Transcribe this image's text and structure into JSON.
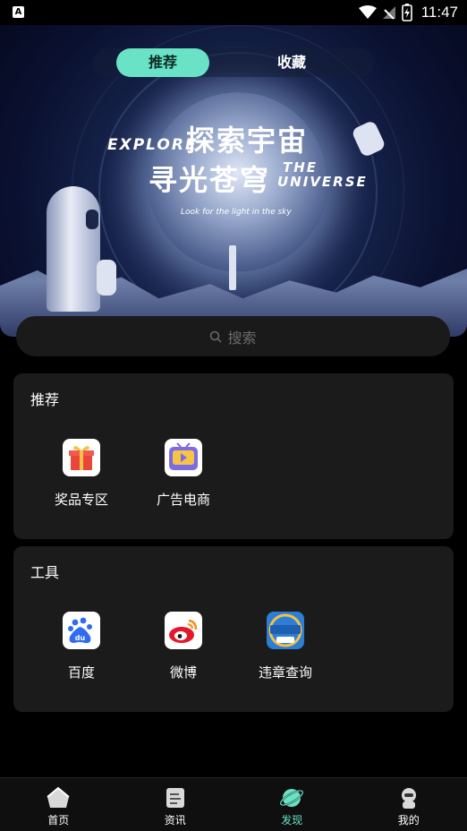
{
  "status_bar": {
    "time": "11:47",
    "app_icon_letter": "A"
  },
  "banner": {
    "tabs": [
      {
        "label": "推荐",
        "active": true
      },
      {
        "label": "收藏",
        "active": false
      }
    ],
    "headline_cn_1": "探索宇宙",
    "headline_cn_2": "寻光苍穹",
    "headline_en_1": "EXPLORE",
    "headline_en_2a": "THE",
    "headline_en_2b": "UNIVERSE",
    "tagline": "Look for the light in the sky"
  },
  "search": {
    "placeholder": "搜索",
    "icon": "search-icon"
  },
  "sections": [
    {
      "title": "推荐",
      "items": [
        {
          "label": "奖品专区",
          "icon": "gift-icon",
          "color": "#e8463a"
        },
        {
          "label": "广告电商",
          "icon": "tv-play-icon",
          "color": "#7b6ce6"
        }
      ]
    },
    {
      "title": "工具",
      "items": [
        {
          "label": "百度",
          "icon": "baidu-icon",
          "color": "#2f6cf0"
        },
        {
          "label": "微博",
          "icon": "weibo-icon",
          "color": "#e6162d"
        },
        {
          "label": "违章查询",
          "icon": "traffic-violation-icon",
          "color": "#2d7fd6",
          "badge": "违章查询"
        }
      ]
    }
  ],
  "bottom_nav": [
    {
      "label": "首页",
      "icon": "home-icon",
      "active": false
    },
    {
      "label": "资讯",
      "icon": "news-icon",
      "active": false
    },
    {
      "label": "发现",
      "icon": "planet-icon",
      "active": true
    },
    {
      "label": "我的",
      "icon": "profile-icon",
      "active": false
    }
  ],
  "colors": {
    "accent": "#69e2c6",
    "card_bg": "#1b1b1b",
    "page_bg": "#000000"
  }
}
